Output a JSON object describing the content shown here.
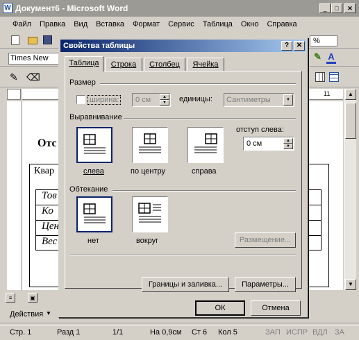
{
  "window": {
    "title": "Документ6 - Microsoft Word"
  },
  "menu": [
    "Файл",
    "Правка",
    "Вид",
    "Вставка",
    "Формат",
    "Сервис",
    "Таблица",
    "Окно",
    "Справка"
  ],
  "toolbar": {
    "font_name": "Times New Ro",
    "zoom": "%",
    "actions": "Действия"
  },
  "ruler_label": "11",
  "document": {
    "heading_fragment": "Отс",
    "table_header": "Квар",
    "rows": [
      "Тов",
      "Ко",
      "Цен",
      "Вес"
    ]
  },
  "dialog": {
    "title": "Свойства таблицы",
    "help": "?",
    "close": "✕",
    "tabs": [
      "Таблица",
      "Строка",
      "Столбец",
      "Ячейка"
    ],
    "size": {
      "group": "Размер",
      "width_label": "ширина:",
      "width_value": "0 см",
      "units_label": "единицы:",
      "units_value": "Сантиметры"
    },
    "alignment": {
      "group": "Выравнивание",
      "options": [
        "слева",
        "по центру",
        "справа"
      ],
      "indent_label": "отступ слева:",
      "indent_value": "0 см"
    },
    "wrapping": {
      "group": "Обтекание",
      "options": [
        "нет",
        "вокруг"
      ],
      "placement_button": "Размещение..."
    },
    "borders_button": "Границы и заливка...",
    "params_button": "Параметры...",
    "ok": "ОК",
    "cancel": "Отмена"
  },
  "status": {
    "page": "Стр. 1",
    "section": "Разд 1",
    "pages": "1/1",
    "at": "На 0,9см",
    "line": "Ст 6",
    "col": "Кол 5",
    "rec": "ЗАП",
    "trk": "ИСПР",
    "ext": "ВДЛ",
    "ovr": "ЗА"
  }
}
